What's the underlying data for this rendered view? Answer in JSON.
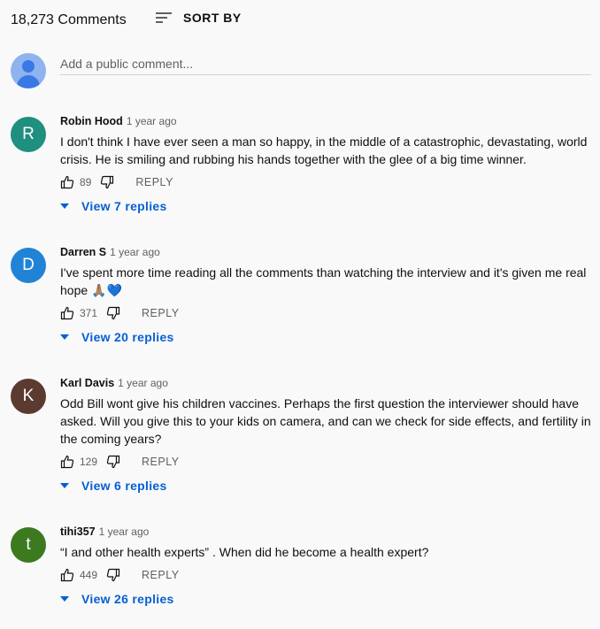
{
  "header": {
    "count": "18,273 Comments",
    "sort_label": "SORT BY"
  },
  "add_comment": {
    "placeholder": "Add a public comment..."
  },
  "colors": {
    "link": "#065fd4",
    "text": "#0f0f0f",
    "muted": "#606060"
  },
  "comments": [
    {
      "initial": "R",
      "avatar_color": "#1f8f7f",
      "author": "Robin Hood",
      "time": "1 year ago",
      "text": "I don't think I have ever seen a man so happy, in the middle of a catastrophic, devastating, world crisis. He is smiling and rubbing his hands together with the glee of a big time winner.",
      "likes": "89",
      "reply_label": "REPLY",
      "view_replies": "View 7 replies"
    },
    {
      "initial": "D",
      "avatar_color": "#2183d6",
      "author": "Darren S",
      "time": "1 year ago",
      "text": "I've spent more time reading all the comments than watching the interview and it's given me real hope 🙏🏽💙",
      "likes": "371",
      "reply_label": "REPLY",
      "view_replies": "View 20 replies"
    },
    {
      "initial": "K",
      "avatar_color": "#5b3a30",
      "author": "Karl Davis",
      "time": "1 year ago",
      "text": "Odd Bill wont give his children vaccines. Perhaps the first question the interviewer should have asked. Will you give this to your kids on camera, and can we check for side effects, and fertility in the coming years?",
      "likes": "129",
      "reply_label": "REPLY",
      "view_replies": "View 6 replies"
    },
    {
      "initial": "t",
      "avatar_color": "#3c7a20",
      "author": "tihi357",
      "time": "1 year ago",
      "text": "“I and other health experts” . When did he become a health expert?",
      "likes": "449",
      "reply_label": "REPLY",
      "view_replies": "View 26 replies"
    }
  ]
}
